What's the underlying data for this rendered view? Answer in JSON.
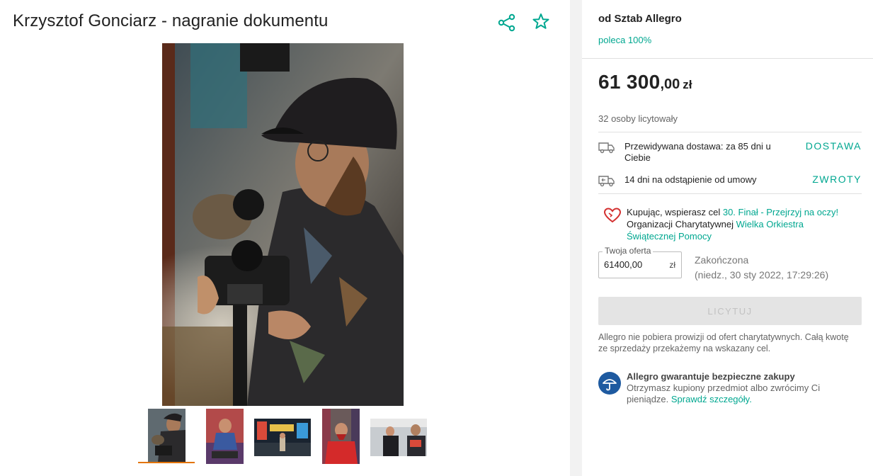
{
  "product": {
    "title": "Krzysztof Gonciarz - nagranie dokumentu"
  },
  "icons": {
    "share": "share-icon",
    "favorite": "star-icon",
    "delivery": "truck-icon",
    "returns": "return-truck-icon",
    "charity": "heart-icon",
    "guarantee": "umbrella-icon"
  },
  "gallery": {
    "thumbnail_count": 5,
    "active_index": 0
  },
  "seller": {
    "name": "od Sztab Allegro",
    "recommend": "poleca 100%"
  },
  "price": {
    "integer": "61 300",
    "decimal": ",00",
    "currency": "zł"
  },
  "bidders": "32 osoby licytowały",
  "delivery": {
    "text": "Przewidywana dostawa: za 85 dni u Ciebie",
    "link": "DOSTAWA"
  },
  "returns": {
    "text": "14 dni na odstąpienie od umowy",
    "link": "ZWROTY"
  },
  "charity": {
    "prefix": "Kupując, wspierasz cel ",
    "goal_link": "30. Finał - Przejrzyj na oczy!",
    "middle": " Organizacji Charytatywnej ",
    "org_link": "Wielka Orkiestra Świątecznej Pomocy"
  },
  "offer": {
    "legend": "Twoja oferta",
    "value": "61400,00",
    "unit": "zł"
  },
  "status": {
    "label": "Zakończona",
    "date": "(niedz., 30 sty 2022, 17:29:26)"
  },
  "bid_button": "LICYTUJ",
  "fee_note": "Allegro nie pobiera prowizji od ofert charytatywnych. Całą kwotę ze sprzedaży przekażemy na wskazany cel.",
  "guarantee": {
    "title": "Allegro gwarantuje bezpieczne zakupy",
    "text": "Otrzymasz kupiony przedmiot albo zwrócimy Ci pieniądze. ",
    "link": "Sprawdź szczegóły."
  },
  "colors": {
    "accent": "#00a790",
    "active_thumb": "#e37400",
    "heart": "#d32f2f",
    "umbrella": "#1e5aa0"
  }
}
